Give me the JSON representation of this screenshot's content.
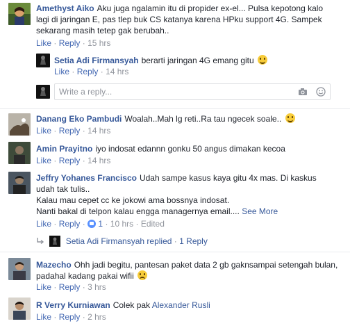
{
  "comments": [
    {
      "author": "Amethyst Aiko",
      "text_lines": [
        "Aku juga ngalamin itu di propider ex-el... Pulsa kepotong kalo",
        "lagi di jaringan E, pas tlep buk CS katanya karena HPku support 4G. Sampek",
        "sekarang masih tetep gak berubah.."
      ],
      "like": "Like",
      "reply": "Reply",
      "time": "15 hrs",
      "sep": "·"
    },
    {
      "author": "Setia Adi Firmansyah",
      "text": "berarti jaringan 4G emang gitu",
      "like": "Like",
      "reply": "Reply",
      "time": "14 hrs",
      "sep": "·"
    },
    {
      "author": "Danang Eko Pambudi",
      "text": "Woalah..Mah lg reti..Ra tau ngecek soale..",
      "like": "Like",
      "reply": "Reply",
      "time": "14 hrs",
      "sep": "·"
    },
    {
      "author": "Amin Prayitno",
      "text": "iyo indosat edannn gonku 50 angus dimakan kecoa",
      "like": "Like",
      "reply": "Reply",
      "time": "14 hrs",
      "sep": "·"
    },
    {
      "author": "Jeffry Yohanes Francisco",
      "text_lines": [
        "Udah sampe kasus kaya gitu 4x mas. Di kaskus",
        "udah tak tulis..",
        "Kalau mau cepet cc ke jokowi ama bossnya indosat.",
        "Nanti bakal di telpon kalau engga managernya email...."
      ],
      "see_more": "See More",
      "like": "Like",
      "reply": "Reply",
      "like_count": "1",
      "time": "10 hrs",
      "edited": "Edited",
      "sep": "·"
    },
    {
      "author": "Mazecho",
      "text_lines": [
        "Ohh jadi begitu, pantesan paket data 2 gb gaknsampai setengah bulan,",
        "padahal kadang pakai wifii"
      ],
      "like": "Like",
      "reply": "Reply",
      "time": "3 hrs",
      "sep": "·"
    },
    {
      "author": "R Verry Kurniawan",
      "text": "Colek pak",
      "mention": "Alexander Rusli",
      "like": "Like",
      "reply": "Reply",
      "time": "2 hrs",
      "sep": "·"
    }
  ],
  "replies_summary": {
    "author": "Setia Adi Firmansyah",
    "label": "replied",
    "sep": "·",
    "count": "1 Reply"
  },
  "reply_box": {
    "placeholder": "Write a reply..."
  },
  "icons": {
    "camera": "camera-icon",
    "emoji": "smiley-icon",
    "reply_arrow": "reply-arrow-icon"
  },
  "colors": {
    "link": "#365899",
    "meta": "#90949c",
    "action": "#4267b2",
    "like_badge": "#5890ff"
  }
}
